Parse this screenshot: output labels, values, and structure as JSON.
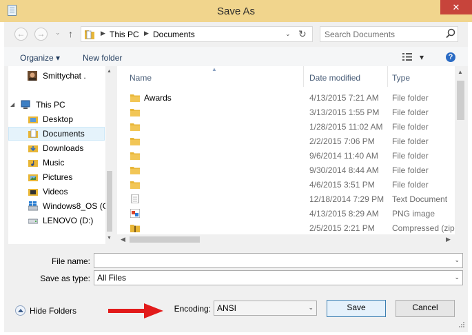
{
  "window": {
    "title": "Save As",
    "close_glyph": "✕"
  },
  "nav": {
    "back_glyph": "←",
    "forward_glyph": "→",
    "up_glyph": "↑",
    "recent_glyph": "⌄"
  },
  "address": {
    "segments": [
      "This PC",
      "Documents"
    ],
    "separator_glyph": "▶",
    "dropdown_glyph": "⌄",
    "refresh_glyph": "↻"
  },
  "search": {
    "placeholder": "Search Documents"
  },
  "toolbar": {
    "organize_label": "Organize ▾",
    "new_folder_label": "New folder",
    "view_dropdown": "▾",
    "help_glyph": "?"
  },
  "nav_pane": {
    "items": [
      {
        "label": "Smittychat .",
        "icon": "user-avatar-icon"
      },
      {
        "label": "This PC",
        "icon": "computer-icon"
      },
      {
        "label": "Desktop",
        "icon": "desktop-folder-icon"
      },
      {
        "label": "Documents",
        "icon": "documents-folder-icon",
        "selected": true
      },
      {
        "label": "Downloads",
        "icon": "downloads-folder-icon"
      },
      {
        "label": "Music",
        "icon": "music-folder-icon"
      },
      {
        "label": "Pictures",
        "icon": "pictures-folder-icon"
      },
      {
        "label": "Videos",
        "icon": "videos-folder-icon"
      },
      {
        "label": "Windows8_OS (C",
        "icon": "windows-drive-icon"
      },
      {
        "label": "LENOVO (D:)",
        "icon": "drive-icon"
      }
    ],
    "expand_glyph": "◢"
  },
  "files": {
    "columns": {
      "name": "Name",
      "date": "Date modified",
      "type": "Type"
    },
    "rows": [
      {
        "name": "Awards",
        "date": "4/13/2015 7:21 AM",
        "type": "File folder",
        "icon": "folder-icon"
      },
      {
        "name": "",
        "date": "3/13/2015 1:55 PM",
        "type": "File folder",
        "icon": "folder-icon"
      },
      {
        "name": "",
        "date": "1/28/2015 11:02 AM",
        "type": "File folder",
        "icon": "folder-icon"
      },
      {
        "name": "",
        "date": "2/2/2015 7:06 PM",
        "type": "File folder",
        "icon": "folder-icon"
      },
      {
        "name": "",
        "date": "9/6/2014 11:40 AM",
        "type": "File folder",
        "icon": "folder-icon"
      },
      {
        "name": "",
        "date": "9/30/2014 8:44 AM",
        "type": "File folder",
        "icon": "folder-icon"
      },
      {
        "name": "",
        "date": "4/6/2015 3:51 PM",
        "type": "File folder",
        "icon": "folder-icon"
      },
      {
        "name": "",
        "date": "12/18/2014 7:29 PM",
        "type": "Text Document",
        "icon": "text-document-icon"
      },
      {
        "name": "",
        "date": "4/13/2015 8:29 AM",
        "type": "PNG image",
        "icon": "png-image-icon"
      },
      {
        "name": "",
        "date": "2/5/2015 2:21 PM",
        "type": "Compressed (zipp",
        "icon": "zip-folder-icon"
      }
    ]
  },
  "form": {
    "file_name_label": "File name:",
    "file_name_value": "",
    "save_type_label": "Save as type:",
    "save_type_value": "All Files",
    "encoding_label": "Encoding:",
    "encoding_value": "ANSI",
    "combo_glyph": "⌄"
  },
  "buttons": {
    "save": "Save",
    "cancel": "Cancel",
    "hide_folders": "Hide Folders"
  },
  "scroll": {
    "up": "▲",
    "down": "▼",
    "left": "◀",
    "right": "▶"
  },
  "colors": {
    "title_bar": "#f1d58d",
    "close": "#c7443b",
    "arrow": "#e21b1b",
    "folder": "#e8b637"
  }
}
